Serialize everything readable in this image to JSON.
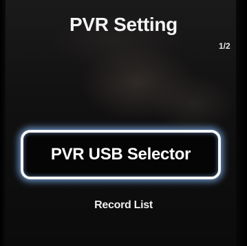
{
  "screen": {
    "title": "PVR Setting",
    "page_indicator": "1/2"
  },
  "menu": {
    "items": [
      {
        "label": "PVR USB Selector",
        "selected": true
      },
      {
        "label": "Record List",
        "selected": false
      }
    ]
  },
  "colors": {
    "background": "#121111",
    "text": "#ffffff",
    "focus_border": "#f5f5f5",
    "focus_glow": "#78aae6"
  }
}
